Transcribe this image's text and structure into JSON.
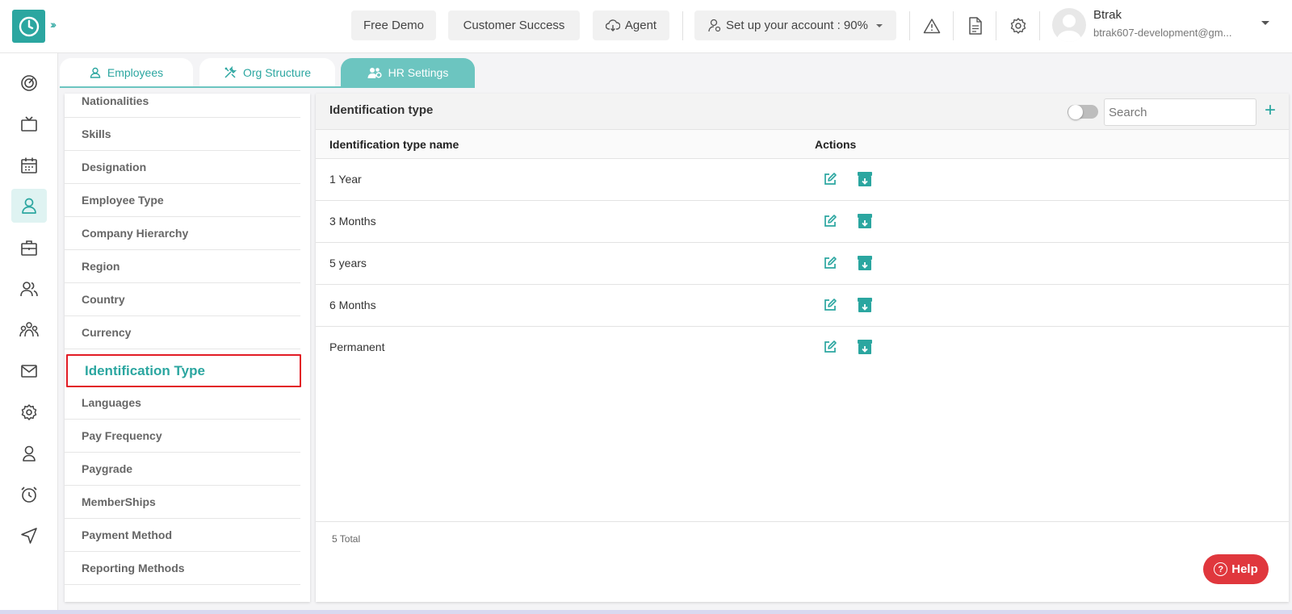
{
  "header": {
    "free_demo": "Free Demo",
    "customer_success": "Customer Success",
    "agent": "Agent",
    "setup_account": "Set up your account : 90%",
    "user_name": "Btrak",
    "user_email": "btrak607-development@gm..."
  },
  "tabs": [
    {
      "label": "Employees",
      "icon": "user-icon"
    },
    {
      "label": "Org Structure",
      "icon": "tools-icon"
    },
    {
      "label": "HR Settings",
      "icon": "users-gear-icon",
      "active": true
    }
  ],
  "menu": {
    "items": [
      "Nationalities",
      "Skills",
      "Designation",
      "Employee Type",
      "Company Hierarchy",
      "Region",
      "Country",
      "Currency",
      "Identification Type",
      "Languages",
      "Pay Frequency",
      "Paygrade",
      "MemberShips",
      "Payment Method",
      "Reporting Methods"
    ],
    "selected": "Identification Type"
  },
  "panel": {
    "title": "Identification type",
    "search_placeholder": "Search",
    "add": "+",
    "columns": [
      "Identification type name",
      "Actions"
    ],
    "rows": [
      "1 Year",
      "3 Months",
      "5 years",
      "6 Months",
      "Permanent"
    ],
    "total": "5 Total"
  },
  "help": {
    "label": "Help",
    "icon_glyph": "?"
  },
  "colors": {
    "accent": "#2ba6a0",
    "tab_active": "#6cc5c0",
    "highlight_border": "#e21b25",
    "help": "#e0373d"
  }
}
